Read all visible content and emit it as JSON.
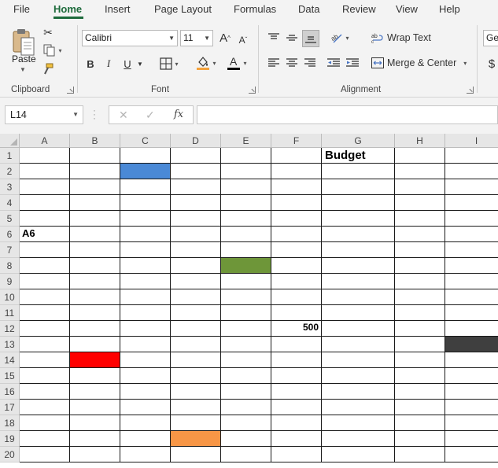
{
  "ribbon_tabs": [
    {
      "label": "File",
      "active": false
    },
    {
      "label": "Home",
      "active": true
    },
    {
      "label": "Insert",
      "active": false
    },
    {
      "label": "Page Layout",
      "active": false
    },
    {
      "label": "Formulas",
      "active": false
    },
    {
      "label": "Data",
      "active": false
    },
    {
      "label": "Review",
      "active": false
    },
    {
      "label": "View",
      "active": false
    },
    {
      "label": "Help",
      "active": false
    }
  ],
  "clipboard": {
    "paste_label": "Paste",
    "group_label": "Clipboard"
  },
  "font": {
    "name": "Calibri",
    "size": "11",
    "group_label": "Font",
    "bold": "B",
    "italic": "I",
    "underline": "U",
    "grow": "A",
    "shrink": "A",
    "font_color_glyph": "A",
    "fill_color": "#f4a23c",
    "font_color": "#000000"
  },
  "alignment": {
    "wrap_text": "Wrap Text",
    "merge_center": "Merge & Center",
    "group_label": "Alignment"
  },
  "number": {
    "format_partial": "Ge",
    "currency_symbol": "$"
  },
  "formula_bar": {
    "name_box": "L14",
    "cancel": "✕",
    "enter": "✓",
    "fx": "fx",
    "content": ""
  },
  "sheet": {
    "columns": [
      "A",
      "B",
      "C",
      "D",
      "E",
      "F",
      "G",
      "H",
      "I"
    ],
    "rows": [
      "1",
      "2",
      "3",
      "4",
      "5",
      "6",
      "7",
      "8",
      "9",
      "10",
      "11",
      "12",
      "13",
      "14",
      "15",
      "16",
      "17",
      "18",
      "19",
      "20"
    ],
    "texts": [
      {
        "cell": "G1",
        "value": "Budget"
      },
      {
        "cell": "A6",
        "value": "A6"
      },
      {
        "cell": "F12",
        "value": "500"
      }
    ],
    "fills": [
      {
        "cell": "C2",
        "color": "#4a89d6"
      },
      {
        "cell": "E8",
        "color": "#6e9639"
      },
      {
        "cell": "I13",
        "color": "#3f3f3f"
      },
      {
        "cell": "B14",
        "color": "#ff0000"
      },
      {
        "cell": "D19",
        "color": "#f79646"
      }
    ]
  }
}
